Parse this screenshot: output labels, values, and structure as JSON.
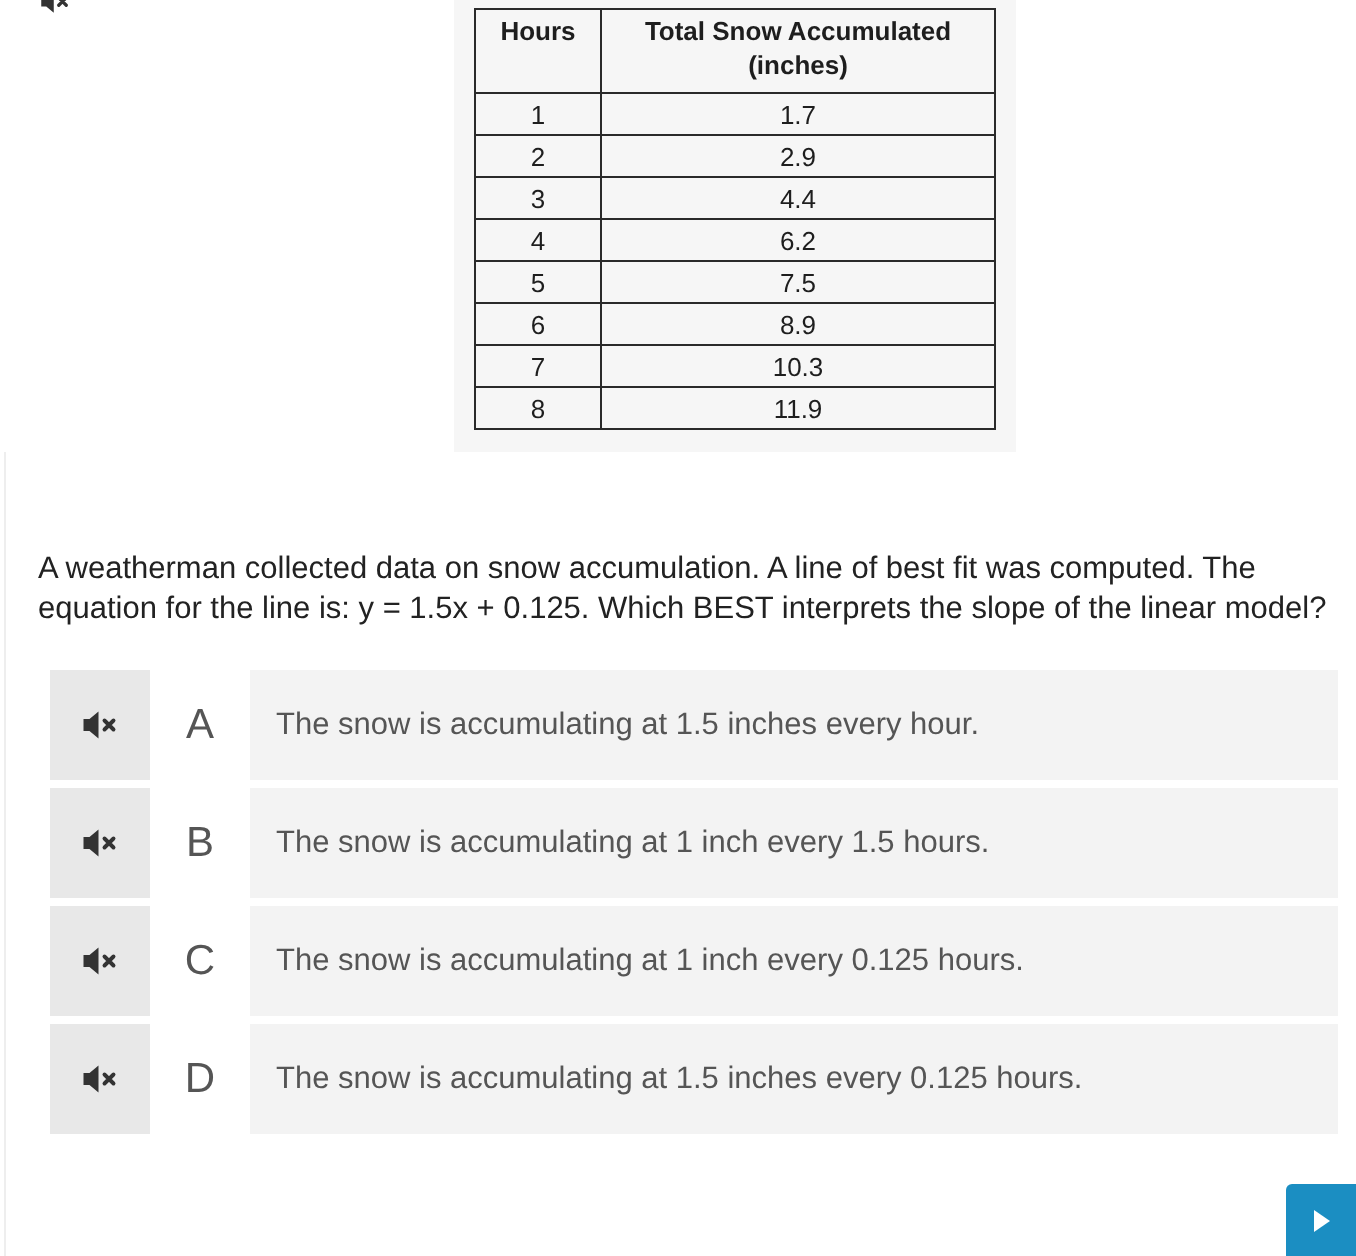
{
  "data_table": {
    "columns": [
      "Hours",
      "Total Snow Accumulated (inches)"
    ],
    "rows": [
      [
        "1",
        "1.7"
      ],
      [
        "2",
        "2.9"
      ],
      [
        "3",
        "4.4"
      ],
      [
        "4",
        "6.2"
      ],
      [
        "5",
        "7.5"
      ],
      [
        "6",
        "8.9"
      ],
      [
        "7",
        "10.3"
      ],
      [
        "8",
        "11.9"
      ]
    ]
  },
  "question": "A weatherman collected data on snow accumulation. A line of best fit was computed. The equation for the line is: y = 1.5x + 0.125. Which BEST interprets the slope of the linear model?",
  "choices": [
    {
      "letter": "A",
      "text": "The snow is accumulating at 1.5 inches every hour.",
      "selected": false
    },
    {
      "letter": "B",
      "text": "The snow is accumulating at 1 inch every 1.5 hours.",
      "selected": false
    },
    {
      "letter": "C",
      "text": "The snow is accumulating at 1 inch every 0.125 hours.",
      "selected": false
    },
    {
      "letter": "D",
      "text": "The snow is accumulating at 1.5 inches every 0.125 hours.",
      "selected": false
    }
  ]
}
